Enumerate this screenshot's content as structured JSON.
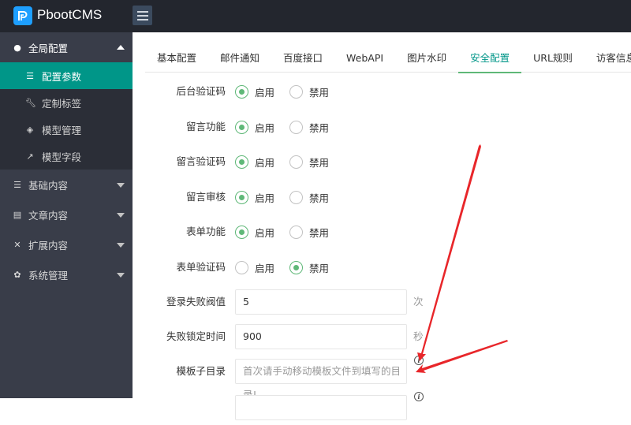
{
  "app": {
    "brand": "PbootCMS",
    "logo_icon": "pboot-logo-icon",
    "menu_toggle_icon": "hamburger-icon"
  },
  "sidebar": {
    "groups": [
      {
        "label": "全局配置",
        "icon": "globe-icon",
        "expanded": true,
        "items": [
          {
            "label": "配置参数",
            "icon": "sliders-icon",
            "active": true
          },
          {
            "label": "定制标签",
            "icon": "wrench-icon",
            "active": false
          },
          {
            "label": "模型管理",
            "icon": "cube-icon",
            "active": false
          },
          {
            "label": "模型字段",
            "icon": "external-link-icon",
            "active": false
          }
        ]
      },
      {
        "label": "基础内容",
        "icon": "sliders-icon",
        "expanded": false
      },
      {
        "label": "文章内容",
        "icon": "file-icon",
        "expanded": false
      },
      {
        "label": "扩展内容",
        "icon": "expand-icon",
        "expanded": false
      },
      {
        "label": "系统管理",
        "icon": "gear-icon",
        "expanded": false
      }
    ]
  },
  "tabs": [
    {
      "label": "基本配置",
      "active": false
    },
    {
      "label": "邮件通知",
      "active": false
    },
    {
      "label": "百度接口",
      "active": false
    },
    {
      "label": "WebAPI",
      "active": false
    },
    {
      "label": "图片水印",
      "active": false
    },
    {
      "label": "安全配置",
      "active": true
    },
    {
      "label": "URL规则",
      "active": false
    },
    {
      "label": "访客信息",
      "active": false
    }
  ],
  "form": {
    "radio_options": {
      "enable": "启用",
      "disable": "禁用"
    },
    "radio_rows": [
      {
        "label": "后台验证码",
        "value": "enable"
      },
      {
        "label": "留言功能",
        "value": "enable"
      },
      {
        "label": "留言验证码",
        "value": "enable"
      },
      {
        "label": "留言审核",
        "value": "enable"
      },
      {
        "label": "表单功能",
        "value": "enable"
      },
      {
        "label": "表单验证码",
        "value": "disable"
      }
    ],
    "login_fail_threshold": {
      "label": "登录失败阀值",
      "value": "5",
      "unit": "次"
    },
    "lock_time": {
      "label": "失败锁定时间",
      "value": "900",
      "unit": "秒"
    },
    "template_subdir": {
      "label": "模板子目录",
      "value": "",
      "placeholder": "首次请手动移动模板文件到填写的目录!",
      "info_icon": "info-icon"
    }
  },
  "annotation": {
    "arrow_color": "#e8262a"
  },
  "colors": {
    "topbar": "#23262e",
    "sidebar": "#393d49",
    "active_item": "#009688",
    "radio_checked": "#5fb878"
  }
}
